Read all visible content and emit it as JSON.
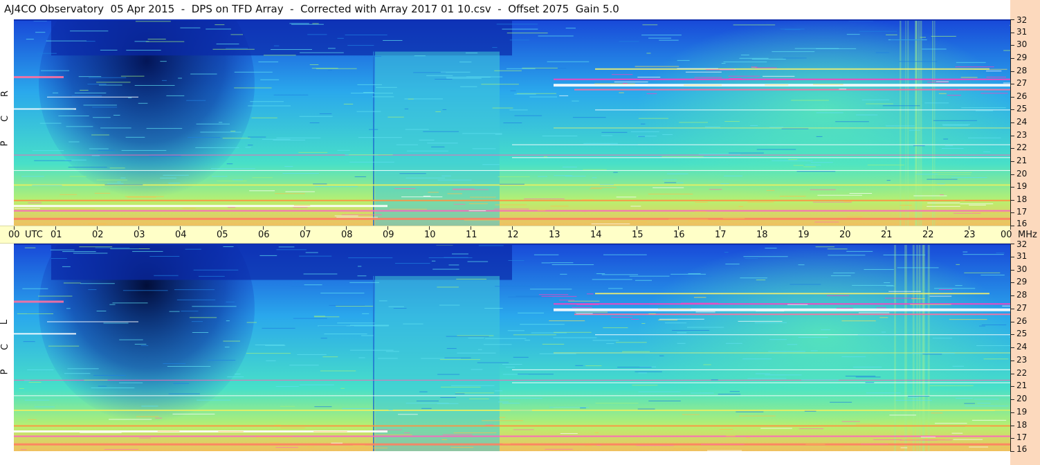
{
  "title": "AJ4CO Observatory  05 Apr 2015  -  DPS on TFD Array  -  Corrected with Array 2017 01 10.csv  -  Offset 2075  Gain 5.0",
  "time_axis": {
    "labels": [
      "00",
      "01",
      "02",
      "03",
      "04",
      "05",
      "06",
      "07",
      "08",
      "09",
      "10",
      "11",
      "12",
      "13",
      "14",
      "15",
      "16",
      "17",
      "18",
      "19",
      "20",
      "21",
      "22",
      "23",
      "00"
    ],
    "utc_label": "UTC",
    "mhz_label": "MHz"
  },
  "freq_ticks": [
    "32",
    "31",
    "30",
    "29",
    "28",
    "27",
    "26",
    "25",
    "24",
    "23",
    "22",
    "21",
    "20",
    "19",
    "18",
    "17",
    "16"
  ],
  "panels": [
    {
      "id": "rcp",
      "label_letters": [
        "R",
        "C",
        "P"
      ]
    },
    {
      "id": "lcp",
      "label_letters": [
        "L",
        "C",
        "P"
      ]
    }
  ],
  "chart_data": {
    "type": "heatmap",
    "title": "AJ4CO Observatory  05 Apr 2015  -  DPS on TFD Array  -  Corrected with Array 2017 01 10.csv  -  Offset 2075  Gain 5.0",
    "x": {
      "label": "UTC",
      "range": [
        0,
        24
      ],
      "unit": "hour"
    },
    "y": {
      "label": "MHz",
      "range": [
        16,
        32
      ]
    },
    "series": [
      {
        "name": "RCP"
      },
      {
        "name": "LCP"
      }
    ],
    "legend": "none",
    "grid": false
  }
}
